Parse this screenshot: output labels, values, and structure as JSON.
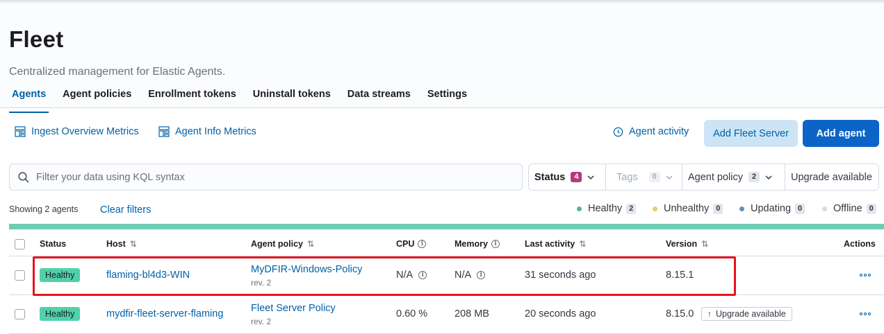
{
  "page": {
    "title": "Fleet",
    "subtitle": "Centralized management for Elastic Agents."
  },
  "tabs": [
    {
      "label": "Agents",
      "active": true
    },
    {
      "label": "Agent policies"
    },
    {
      "label": "Enrollment tokens"
    },
    {
      "label": "Uninstall tokens"
    },
    {
      "label": "Data streams"
    },
    {
      "label": "Settings"
    }
  ],
  "toolbar": {
    "ingest_metrics": "Ingest Overview Metrics",
    "agent_info_metrics": "Agent Info Metrics",
    "agent_activity": "Agent activity",
    "add_fleet_server": "Add Fleet Server",
    "add_agent": "Add agent"
  },
  "search": {
    "placeholder": "Filter your data using KQL syntax",
    "value": ""
  },
  "filters": {
    "status": {
      "label": "Status",
      "count": "4"
    },
    "tags": {
      "label": "Tags",
      "count": "0"
    },
    "agent_policy": {
      "label": "Agent policy",
      "count": "2"
    },
    "upgrade": {
      "label": "Upgrade available"
    }
  },
  "summary": {
    "showing": "Showing 2 agents",
    "clear_filters": "Clear filters",
    "legend": [
      {
        "label": "Healthy",
        "count": "2",
        "color": "#54b399"
      },
      {
        "label": "Unhealthy",
        "count": "0",
        "color": "#e7cf5c"
      },
      {
        "label": "Updating",
        "count": "0",
        "color": "#6092c0"
      },
      {
        "label": "Offline",
        "count": "0",
        "color": "#d3dae6"
      }
    ]
  },
  "table": {
    "headers": {
      "status": "Status",
      "host": "Host",
      "agent_policy": "Agent policy",
      "cpu": "CPU",
      "memory": "Memory",
      "last_activity": "Last activity",
      "version": "Version",
      "actions": "Actions"
    },
    "rows": [
      {
        "status": "Healthy",
        "host": "flaming-bl4d3-WIN",
        "policy": "MyDFIR-Windows-Policy",
        "rev": "rev. 2",
        "cpu": "N/A",
        "memory": "N/A",
        "last_activity": "31 seconds ago",
        "version": "8.15.1"
      },
      {
        "status": "Healthy",
        "host": "mydfir-fleet-server-flaming",
        "policy": "Fleet Server Policy",
        "rev": "rev. 2",
        "cpu": "0.60 %",
        "memory": "208 MB",
        "last_activity": "20 seconds ago",
        "version": "8.15.0",
        "upgrade_label": "Upgrade available"
      }
    ]
  },
  "colors": {
    "accent": "#0061a6",
    "primary_button": "#0b64c6",
    "healthy_badge": "#4fd1ab",
    "status_count": "#b4397a",
    "highlight": "#e8121d"
  }
}
